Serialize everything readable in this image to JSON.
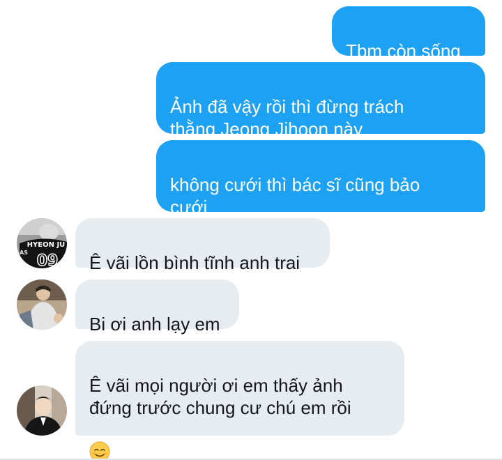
{
  "messages": [
    {
      "direction": "sent",
      "text": "Tbm còn sống"
    },
    {
      "direction": "sent",
      "text": "Ảnh đã vậy rồi thì đừng trách\nthằng Jeong Jihoon này"
    },
    {
      "direction": "sent",
      "text": "không cưới thì bác sĩ cũng bảo\ncưới"
    },
    {
      "direction": "received",
      "text": "Ê vãi lồn bình tĩnh anh trai",
      "avatar": "avatar-jersey"
    },
    {
      "direction": "received",
      "text": "Bi ơi anh lạy em",
      "avatar": "avatar-photo"
    },
    {
      "direction": "received",
      "text": "Ê vãi mọi người ơi em thấy ảnh\nđứng trước chung cư chú em rồi",
      "emoji": "smiling-face-emoji",
      "avatar": "avatar-portrait"
    }
  ],
  "avatars": {
    "jersey_text": "HYEON JU",
    "jersey_number": "09",
    "jersey_logo": "AS"
  },
  "colors": {
    "sent_bubble": "#1da1f2",
    "received_bubble": "#e6ecf0",
    "received_text": "#14171a"
  }
}
